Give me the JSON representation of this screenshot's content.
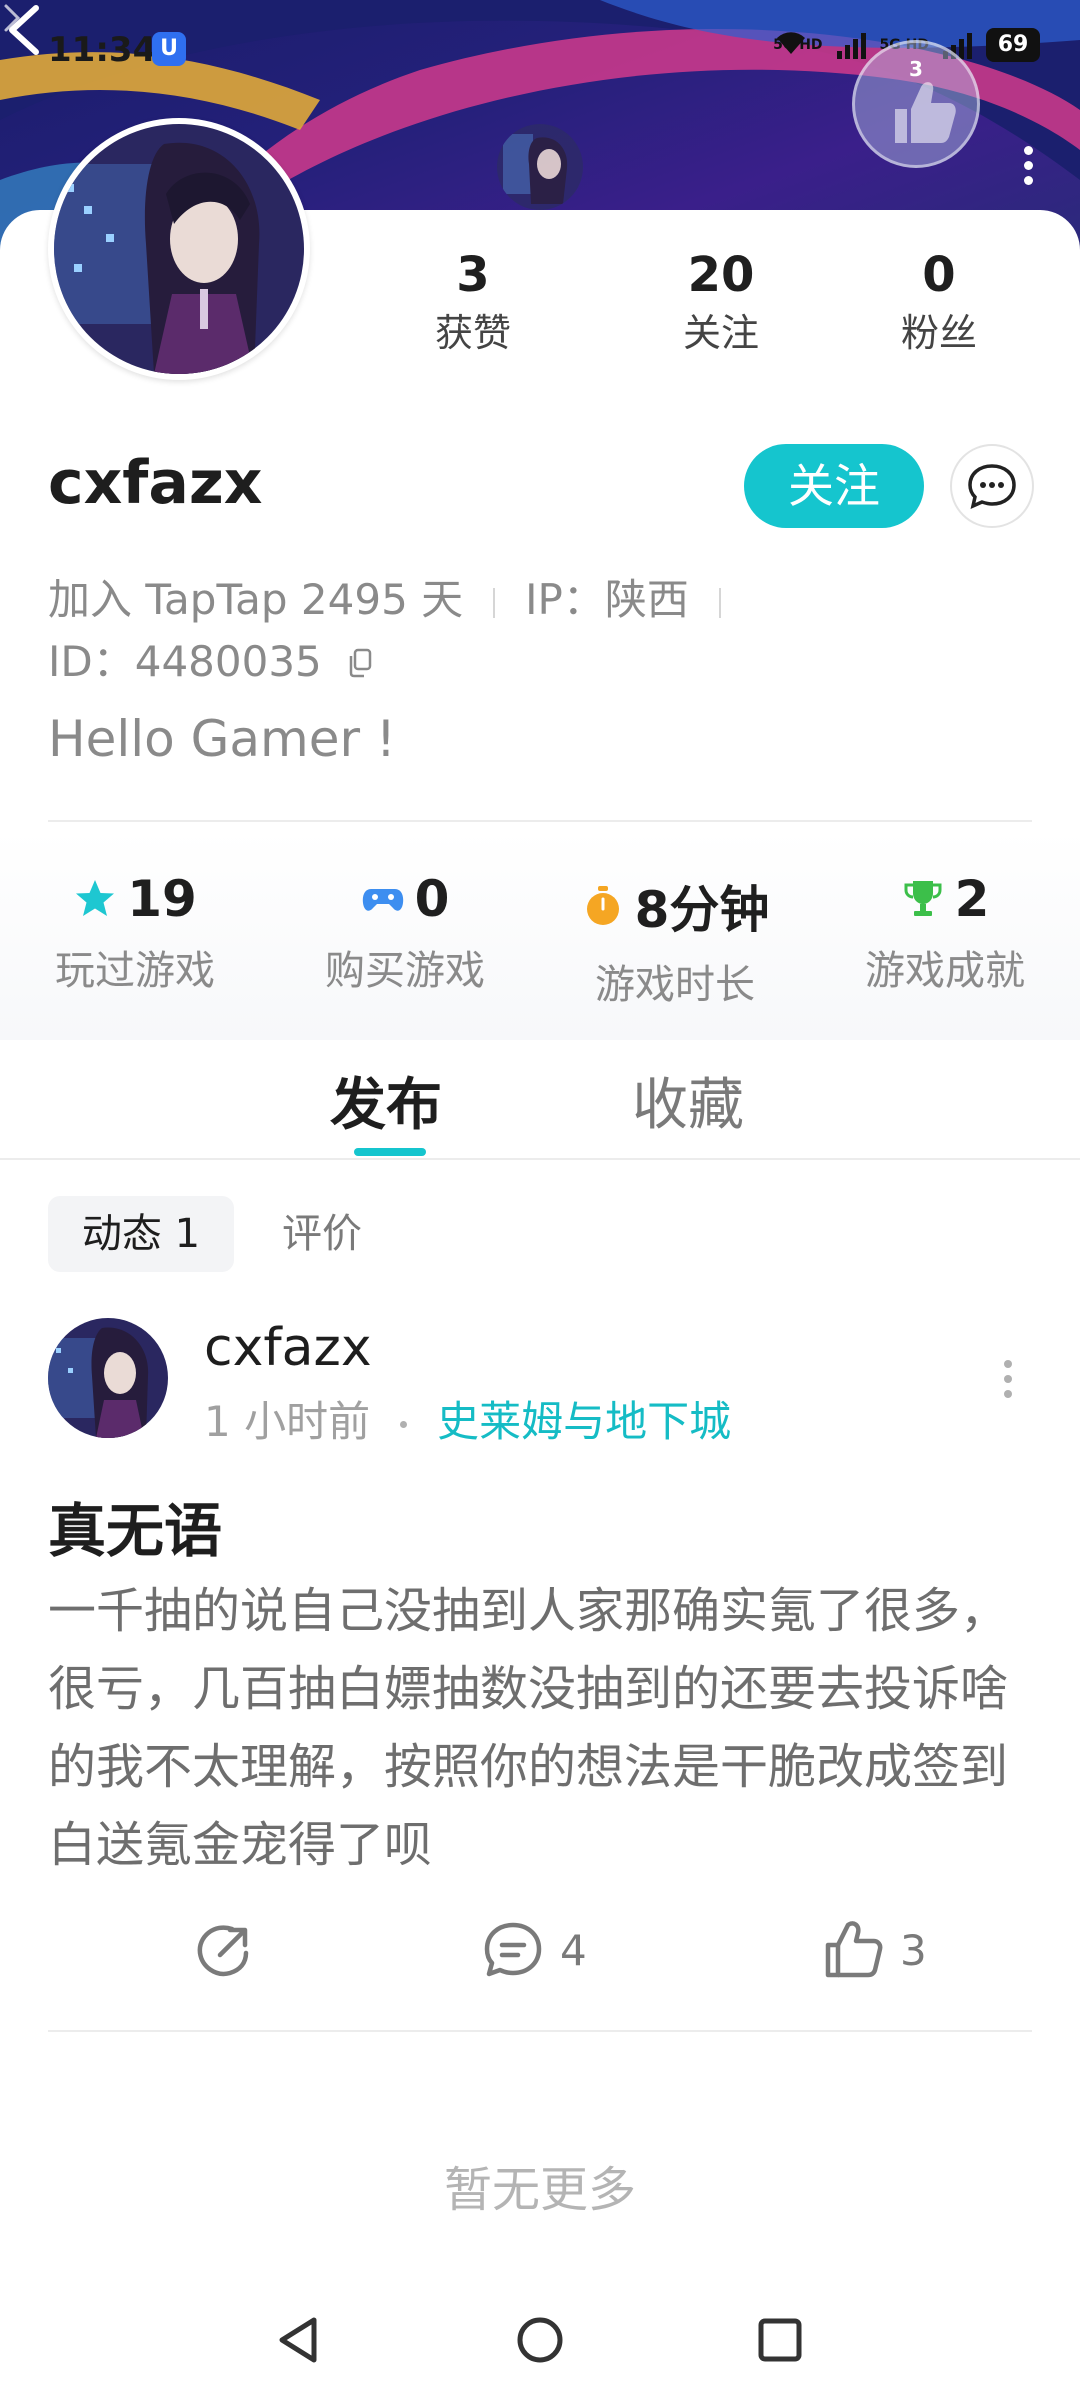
{
  "status_bar": {
    "time": "11:34",
    "app_badge": "U",
    "network_1": "5G HD",
    "network_2": "5G HD",
    "battery": "69"
  },
  "header": {
    "like_badge_count": "3"
  },
  "stats": [
    {
      "value": "3",
      "label": "获赞"
    },
    {
      "value": "20",
      "label": "关注"
    },
    {
      "value": "0",
      "label": "粉丝"
    }
  ],
  "profile": {
    "username": "cxfazx",
    "follow_label": "关注",
    "joined": "加入 TapTap 2495 天",
    "ip": "IP：陕西",
    "id": "ID：4480035",
    "bio": "Hello Gamer !"
  },
  "game_stats": [
    {
      "icon": "star-icon",
      "value": "19",
      "label": "玩过游戏",
      "color": "#1ec7d1"
    },
    {
      "icon": "gamepad-icon",
      "value": "0",
      "label": "购买游戏",
      "color": "#3d8ef0"
    },
    {
      "icon": "stopwatch-icon",
      "value": "8分钟",
      "label": "游戏时长",
      "color": "#f5a623"
    },
    {
      "icon": "trophy-icon",
      "value": "2",
      "label": "游戏成就",
      "color": "#3cbf4a"
    }
  ],
  "tabs": {
    "active": "发布",
    "inactive": "收藏"
  },
  "subtabs": {
    "active": "动态 1",
    "inactive": "评价"
  },
  "post": {
    "author": "cxfazx",
    "time": "1 小时前",
    "game": "史莱姆与地下城",
    "title": "真无语",
    "body": "一千抽的说自己没抽到人家那确实氪了很多，很亏，几百抽白嫖抽数没抽到的还要去投诉啥的我不太理解，按照你的想法是干脆改成签到白送氪金宠得了呗",
    "comments": "4",
    "likes": "3"
  },
  "footer": {
    "no_more": "暂无更多"
  },
  "colors": {
    "accent": "#15c5ce",
    "banner": "#24207a"
  }
}
